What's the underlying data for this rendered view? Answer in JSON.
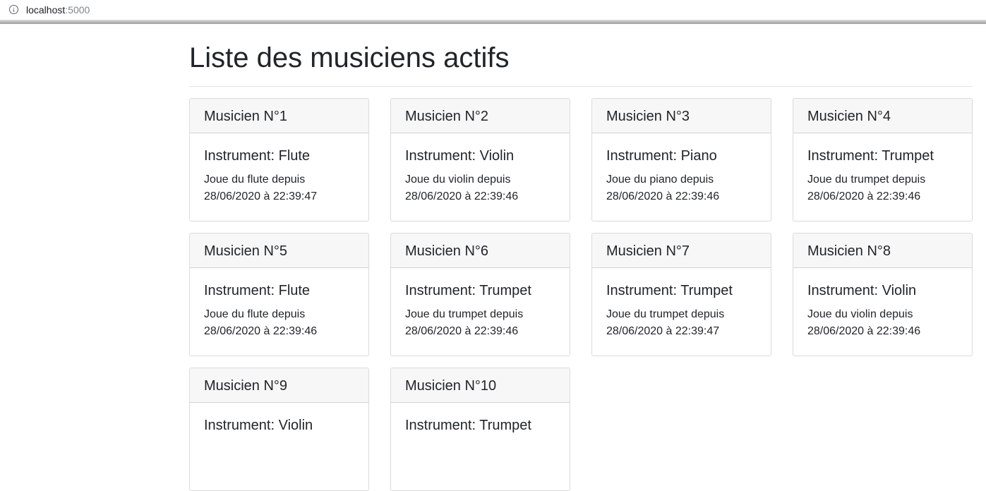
{
  "browser": {
    "url_host": "localhost",
    "url_port": ":5000",
    "icon": "info-icon"
  },
  "page": {
    "title": "Liste des musiciens actifs"
  },
  "musicians": [
    {
      "header": "Musicien N°1",
      "instrument": "Instrument: Flute",
      "since": "Joue du flute depuis",
      "date": "28/06/2020 à 22:39:47"
    },
    {
      "header": "Musicien N°2",
      "instrument": "Instrument: Violin",
      "since": "Joue du violin depuis",
      "date": "28/06/2020 à 22:39:46"
    },
    {
      "header": "Musicien N°3",
      "instrument": "Instrument: Piano",
      "since": "Joue du piano depuis",
      "date": "28/06/2020 à 22:39:46"
    },
    {
      "header": "Musicien N°4",
      "instrument": "Instrument: Trumpet",
      "since": "Joue du trumpet depuis",
      "date": "28/06/2020 à 22:39:46"
    },
    {
      "header": "Musicien N°5",
      "instrument": "Instrument: Flute",
      "since": "Joue du flute depuis",
      "date": "28/06/2020 à 22:39:46"
    },
    {
      "header": "Musicien N°6",
      "instrument": "Instrument: Trumpet",
      "since": "Joue du trumpet depuis",
      "date": "28/06/2020 à 22:39:46"
    },
    {
      "header": "Musicien N°7",
      "instrument": "Instrument: Trumpet",
      "since": "Joue du trumpet depuis",
      "date": "28/06/2020 à 22:39:47"
    },
    {
      "header": "Musicien N°8",
      "instrument": "Instrument: Violin",
      "since": "Joue du violin depuis",
      "date": "28/06/2020 à 22:39:46"
    },
    {
      "header": "Musicien N°9",
      "instrument": "Instrument: Violin",
      "since": "",
      "date": ""
    },
    {
      "header": "Musicien N°10",
      "instrument": "Instrument: Trumpet",
      "since": "",
      "date": ""
    }
  ]
}
